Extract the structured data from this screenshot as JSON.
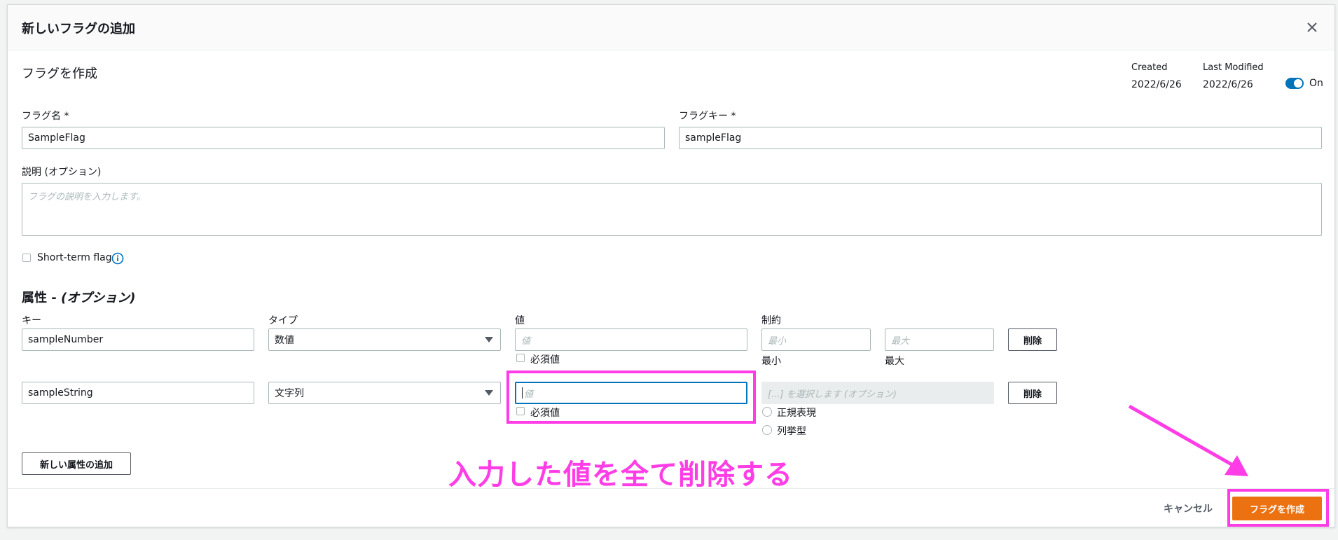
{
  "dialog": {
    "title": "新しいフラグの追加"
  },
  "section": {
    "title": "フラグを作成"
  },
  "meta": {
    "created_label": "Created",
    "created_value": "2022/6/26",
    "modified_label": "Last Modified",
    "modified_value": "2022/6/26",
    "toggle_label": "On"
  },
  "form": {
    "flag_name_label": "フラグ名 *",
    "flag_name_value": "SampleFlag",
    "flag_key_label": "フラグキー *",
    "flag_key_value": "sampleFlag",
    "description_label": "説明 (オプション)",
    "description_placeholder": "フラグの説明を入力します。",
    "short_term_label": "Short-term flag"
  },
  "attributes": {
    "title_prefix": "属性 - ",
    "title_suffix": "(オプション)",
    "col_key": "キー",
    "col_type": "タイプ",
    "col_value": "値",
    "col_constraint": "制約",
    "rows": [
      {
        "key": "sampleNumber",
        "type": "数値",
        "value_placeholder": "値",
        "required_label": "必須値",
        "min_placeholder": "最小",
        "max_placeholder": "最大",
        "min_label": "最小",
        "max_label": "最大",
        "delete_label": "削除"
      },
      {
        "key": "sampleString",
        "type": "文字列",
        "value_placeholder": "値",
        "required_label": "必須値",
        "constraint_placeholder": "[...] を選択します (オプション)",
        "regex_label": "正規表現",
        "enum_label": "列挙型",
        "delete_label": "削除"
      }
    ],
    "add_button": "新しい属性の追加"
  },
  "footer": {
    "cancel_label": "キャンセル",
    "create_label": "フラグを作成"
  },
  "annotation": {
    "text": "入力した値を全て削除する",
    "color": "#ff3de6"
  },
  "colors": {
    "primary": "#ec7211",
    "toggle": "#0073bb",
    "info": "#0073bb"
  }
}
